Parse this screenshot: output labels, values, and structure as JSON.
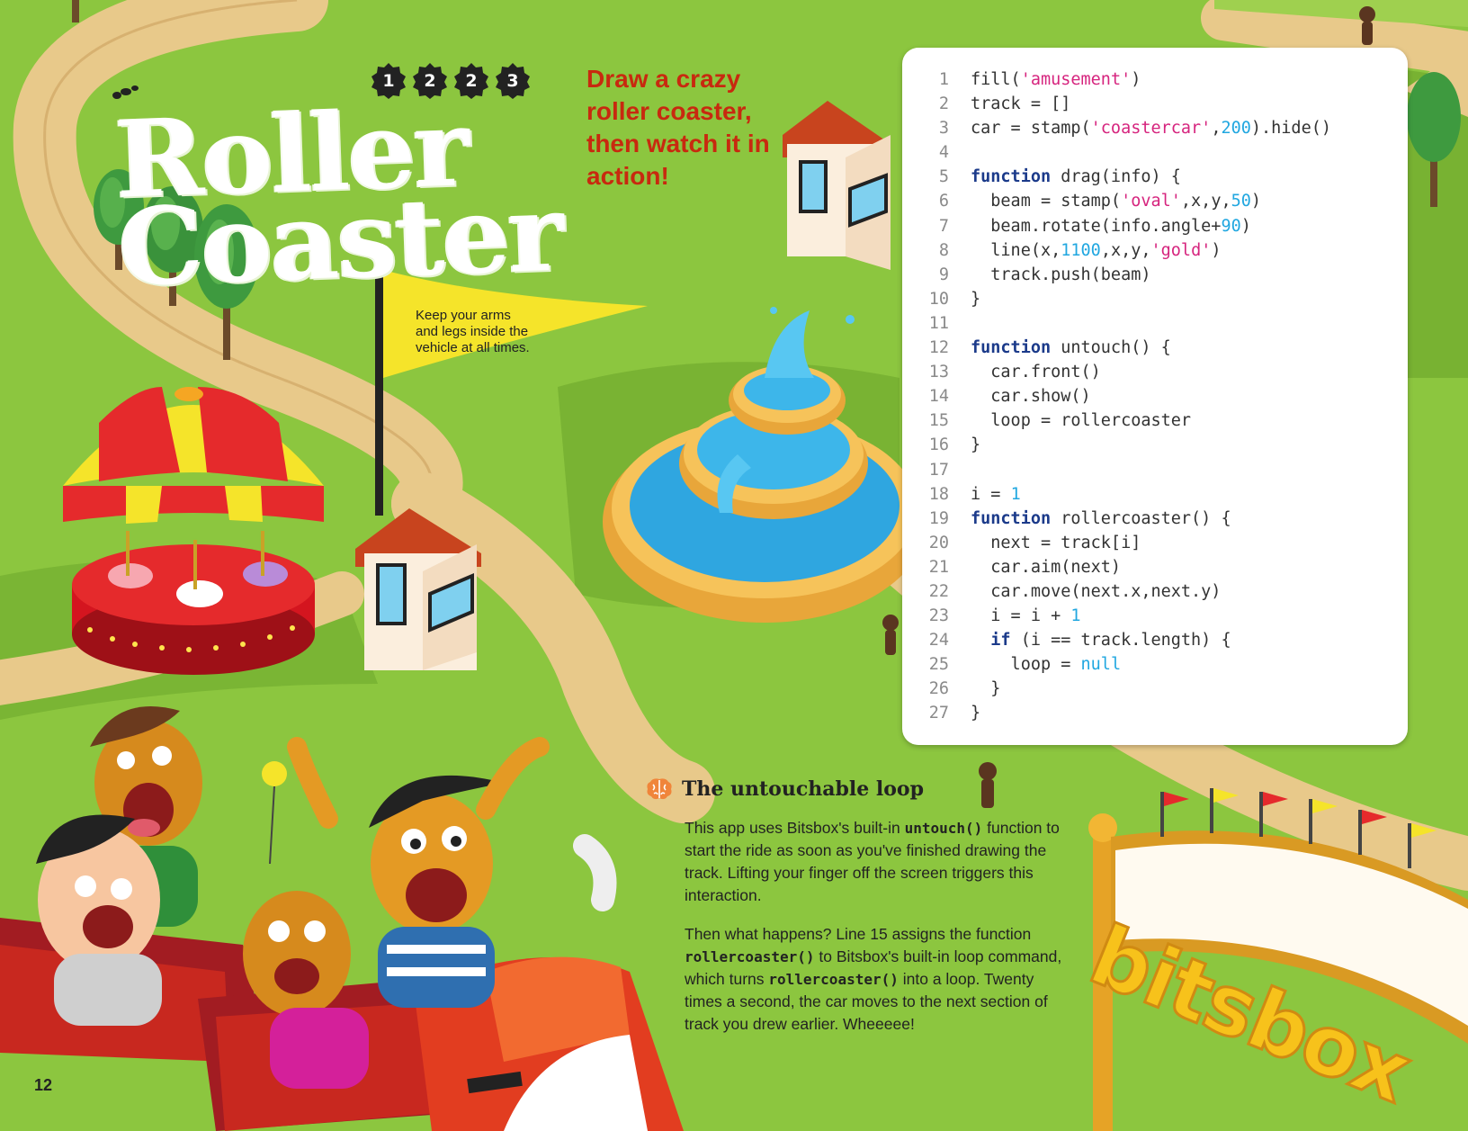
{
  "page": {
    "badges": [
      "1",
      "2",
      "2",
      "3"
    ],
    "title_lines": [
      "Roller",
      "Coaster"
    ],
    "subtitle": "Draw a crazy roller coaster, then watch it in action!",
    "flag_text": "Keep your arms and legs inside the vehicle at all times.",
    "sign_text": "bitsbox",
    "page_number": "12"
  },
  "code": {
    "lines": [
      {
        "n": "1",
        "tokens": [
          [
            "plain",
            "fill("
          ],
          [
            "str",
            "'amusement'"
          ],
          [
            "plain",
            ")"
          ]
        ]
      },
      {
        "n": "2",
        "tokens": [
          [
            "plain",
            "track = []"
          ]
        ]
      },
      {
        "n": "3",
        "tokens": [
          [
            "plain",
            "car = stamp("
          ],
          [
            "str",
            "'coastercar'"
          ],
          [
            "plain",
            ","
          ],
          [
            "num",
            "200"
          ],
          [
            "plain",
            ").hide()"
          ]
        ]
      },
      {
        "n": "4",
        "tokens": []
      },
      {
        "n": "5",
        "tokens": [
          [
            "kw",
            "function"
          ],
          [
            "plain",
            " drag(info) {"
          ]
        ]
      },
      {
        "n": "6",
        "tokens": [
          [
            "plain",
            "  beam = stamp("
          ],
          [
            "str",
            "'oval'"
          ],
          [
            "plain",
            ",x,y,"
          ],
          [
            "num",
            "50"
          ],
          [
            "plain",
            ")"
          ]
        ]
      },
      {
        "n": "7",
        "tokens": [
          [
            "plain",
            "  beam.rotate(info.angle+"
          ],
          [
            "num",
            "90"
          ],
          [
            "plain",
            ")"
          ]
        ]
      },
      {
        "n": "8",
        "tokens": [
          [
            "plain",
            "  line(x,"
          ],
          [
            "num",
            "1100"
          ],
          [
            "plain",
            ",x,y,"
          ],
          [
            "str",
            "'gold'"
          ],
          [
            "plain",
            ")"
          ]
        ]
      },
      {
        "n": "9",
        "tokens": [
          [
            "plain",
            "  track.push(beam)"
          ]
        ]
      },
      {
        "n": "10",
        "tokens": [
          [
            "plain",
            "}"
          ]
        ]
      },
      {
        "n": "11",
        "tokens": []
      },
      {
        "n": "12",
        "tokens": [
          [
            "kw",
            "function"
          ],
          [
            "plain",
            " untouch() {"
          ]
        ]
      },
      {
        "n": "13",
        "tokens": [
          [
            "plain",
            "  car.front()"
          ]
        ]
      },
      {
        "n": "14",
        "tokens": [
          [
            "plain",
            "  car.show()"
          ]
        ]
      },
      {
        "n": "15",
        "tokens": [
          [
            "plain",
            "  loop = rollercoaster"
          ]
        ]
      },
      {
        "n": "16",
        "tokens": [
          [
            "plain",
            "}"
          ]
        ]
      },
      {
        "n": "17",
        "tokens": []
      },
      {
        "n": "18",
        "tokens": [
          [
            "plain",
            "i = "
          ],
          [
            "num",
            "1"
          ]
        ]
      },
      {
        "n": "19",
        "tokens": [
          [
            "kw",
            "function"
          ],
          [
            "plain",
            " rollercoaster() {"
          ]
        ]
      },
      {
        "n": "20",
        "tokens": [
          [
            "plain",
            "  next = track[i]"
          ]
        ]
      },
      {
        "n": "21",
        "tokens": [
          [
            "plain",
            "  car.aim(next)"
          ]
        ]
      },
      {
        "n": "22",
        "tokens": [
          [
            "plain",
            "  car.move(next.x,next.y)"
          ]
        ]
      },
      {
        "n": "23",
        "tokens": [
          [
            "plain",
            "  i = i + "
          ],
          [
            "num",
            "1"
          ]
        ]
      },
      {
        "n": "24",
        "tokens": [
          [
            "plain",
            "  "
          ],
          [
            "kw",
            "if"
          ],
          [
            "plain",
            " (i == track.length) {"
          ]
        ]
      },
      {
        "n": "25",
        "tokens": [
          [
            "plain",
            "    loop = "
          ],
          [
            "num",
            "null"
          ]
        ]
      },
      {
        "n": "26",
        "tokens": [
          [
            "plain",
            "  }"
          ]
        ]
      },
      {
        "n": "27",
        "tokens": [
          [
            "plain",
            "}"
          ]
        ]
      }
    ]
  },
  "section": {
    "icon": "brain-icon",
    "heading": "The untouchable loop",
    "p1_a": "This app uses Bitsbox's built-in ",
    "p1_code": "untouch()",
    "p1_b": " function to start the ride as soon as you've finished drawing the track. Lifting your finger off the screen triggers this interaction.",
    "p2_a": "Then what happens? Line 15 assigns the function ",
    "p2_code1": "rollercoaster()",
    "p2_b": " to Bitsbox's built-in loop command, which turns ",
    "p2_code2": "rollercoaster()",
    "p2_c": " into a loop. Twenty times a second, the car moves to the next section of track you drew earlier. Wheeeee!"
  },
  "colors": {
    "grass": "#8cc63f",
    "path": "#e8c98a",
    "subtitle": "#c8290f",
    "keyword": "#1b3a8a",
    "string": "#d6247e",
    "number": "#21a7e0"
  }
}
